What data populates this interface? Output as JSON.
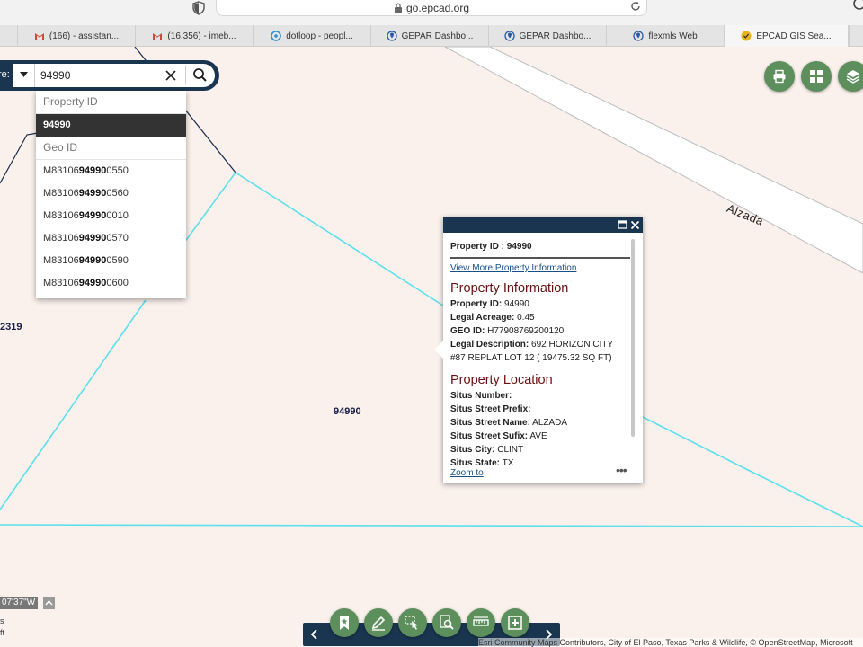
{
  "browser": {
    "url": "go.epcad.org",
    "tabs": [
      {
        "title": "(166) - assistan...",
        "icon": "gmail-icon"
      },
      {
        "title": "(16,356) - imeb...",
        "icon": "gmail-icon"
      },
      {
        "title": "dotloop - peopl...",
        "icon": "dotloop-icon"
      },
      {
        "title": "GEPAR Dashbo...",
        "icon": "map-pin-icon"
      },
      {
        "title": "GEPAR Dashbo...",
        "icon": "map-pin-icon"
      },
      {
        "title": "flexmls Web",
        "icon": "map-pin-icon"
      },
      {
        "title": "EPCAD GIS Sea...",
        "icon": "epcad-icon",
        "active": true
      }
    ]
  },
  "search": {
    "prefix": "re:",
    "value": "94990",
    "suggestions": {
      "property_header": "Property ID",
      "property_items": [
        "94990"
      ],
      "geo_header": "Geo ID",
      "geo_items": [
        {
          "pre": "M83106",
          "match": "94990",
          "post": "0550"
        },
        {
          "pre": "M83106",
          "match": "94990",
          "post": "0560"
        },
        {
          "pre": "M83106",
          "match": "94990",
          "post": "0010"
        },
        {
          "pre": "M83106",
          "match": "94990",
          "post": "0570"
        },
        {
          "pre": "M83106",
          "match": "94990",
          "post": "0590"
        },
        {
          "pre": "M83106",
          "match": "94990",
          "post": "0600"
        }
      ]
    }
  },
  "map": {
    "road_label": "Alzada",
    "parcel_labels": [
      "2319",
      "94990"
    ],
    "parcel_line_color": "#5ce0ec",
    "background": "#faf1ec"
  },
  "popup": {
    "title": "Property ID : 94990",
    "more_link": "View More Property Information",
    "section1": "Property Information",
    "info": [
      {
        "k": "Property ID:",
        "v": " 94990"
      },
      {
        "k": "Legal Acreage:",
        "v": " 0.45"
      },
      {
        "k": "GEO ID:",
        "v": " H77908769200120"
      },
      {
        "k": "Legal Description:",
        "v": " 692 HORIZON CITY #87 REPLAT LOT 12 ( 19475.32 SQ FT)"
      }
    ],
    "section2": "Property Location",
    "location": [
      {
        "k": "Situs Number:",
        "v": ""
      },
      {
        "k": "Situs Street Prefix:",
        "v": ""
      },
      {
        "k": "Situs Street Name:",
        "v": " ALZADA"
      },
      {
        "k": "Situs Street Sufix:",
        "v": " AVE"
      },
      {
        "k": "Situs City:",
        "v": " CLINT"
      },
      {
        "k": "Situs State:",
        "v": " TX"
      }
    ],
    "zoom_link": "Zoom to",
    "more_dots": "•••"
  },
  "footer": {
    "coordinates": "07'37\"W",
    "scale_line1": "s",
    "scale_line2": "ft",
    "attribution": "Esri Community Maps Contributors, City of El Paso, Texas Parks & Wildlife, © OpenStreetMap, Microsoft"
  },
  "colors": {
    "navy": "#1a3550",
    "button_green": "#5c8f5c",
    "section_red": "#6a0f0f"
  }
}
